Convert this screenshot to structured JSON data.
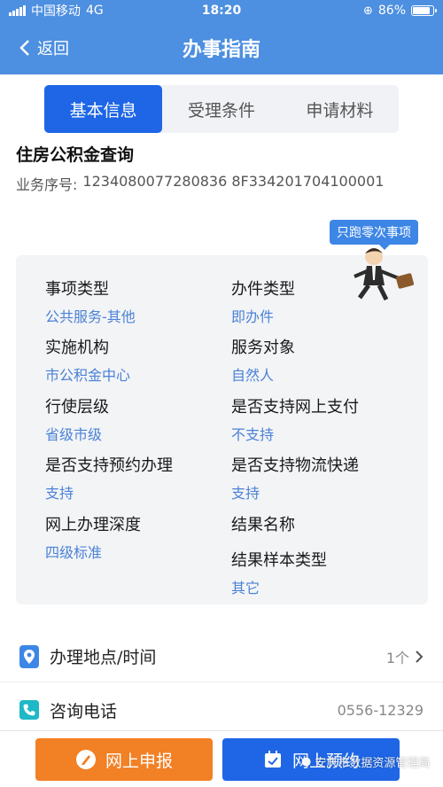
{
  "status": {
    "carrier": "中国移动",
    "network": "4G",
    "time": "18:20",
    "battery": "86%",
    "battery_level": 0.86
  },
  "nav": {
    "back_label": "返回",
    "title": "办事指南"
  },
  "tabs": [
    {
      "label": "基本信息",
      "active": true
    },
    {
      "label": "受理条件",
      "active": false
    },
    {
      "label": "申请材料",
      "active": false
    }
  ],
  "service": {
    "title": "住房公积金查询",
    "serial_label": "业务序号:",
    "serial_value": "1234080077280836 8F334201704100001"
  },
  "promo": "只跑零次事项",
  "info": {
    "item_type": {
      "label": "事项类型",
      "value": "公共服务-其他"
    },
    "handling_type": {
      "label": "办件类型",
      "value": "即办件"
    },
    "agency": {
      "label": "实施机构",
      "value": "市公积金中心"
    },
    "service_target": {
      "label": "服务对象",
      "value": "自然人"
    },
    "level": {
      "label": "行使层级",
      "value": "省级市级"
    },
    "online_payment": {
      "label": "是否支持网上支付",
      "value": "不支持"
    },
    "appointment": {
      "label": "是否支持预约办理",
      "value": "支持"
    },
    "logistics": {
      "label": "是否支持物流快递",
      "value": "支持"
    },
    "depth": {
      "label": "网上办理深度",
      "value": "四级标准"
    },
    "result_name": {
      "label": "结果名称",
      "value": ""
    },
    "result_sample": {
      "label": "结果样本类型",
      "value": "其它"
    }
  },
  "rows": {
    "location": {
      "label": "办理地点/时间",
      "value": "1个"
    },
    "phone": {
      "label": "咨询电话",
      "value": "0556-12329"
    }
  },
  "buttons": {
    "apply": "网上申报",
    "reserve": "网上预约"
  },
  "watermark": "安庆市数据资源管理局",
  "colors": {
    "primary": "#4d8fe0",
    "tab_active": "#1e66e6",
    "apply": "#f28025",
    "value_text": "#4b82d6"
  }
}
